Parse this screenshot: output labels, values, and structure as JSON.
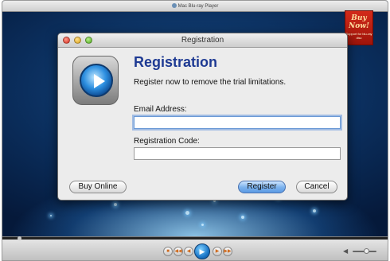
{
  "player": {
    "title": "Mac Blu-ray Player",
    "buy_now_badge": {
      "title": "Buy Now!",
      "subtitle": "Support for blu-ray disc"
    },
    "controls": {
      "progress": 0.04,
      "volume": 0.55,
      "buttons": [
        {
          "icon": "stop-icon",
          "glyph": "■"
        },
        {
          "icon": "rewind-icon",
          "glyph": "◀◀"
        },
        {
          "icon": "previous-icon",
          "glyph": "◀"
        },
        {
          "icon": "next-icon",
          "glyph": "▶"
        },
        {
          "icon": "fast-forward-icon",
          "glyph": "▶▶"
        }
      ],
      "play_glyph": "▶"
    }
  },
  "dialog": {
    "window_title": "Registration",
    "heading": "Registration",
    "description": "Register now to remove the trial limitations.",
    "email_label": "Email Address:",
    "email_value": "",
    "code_label": "Registration Code:",
    "code_value": "",
    "buy_online_label": "Buy Online",
    "register_label": "Register",
    "cancel_label": "Cancel",
    "accent_color": "#1e3a93"
  }
}
